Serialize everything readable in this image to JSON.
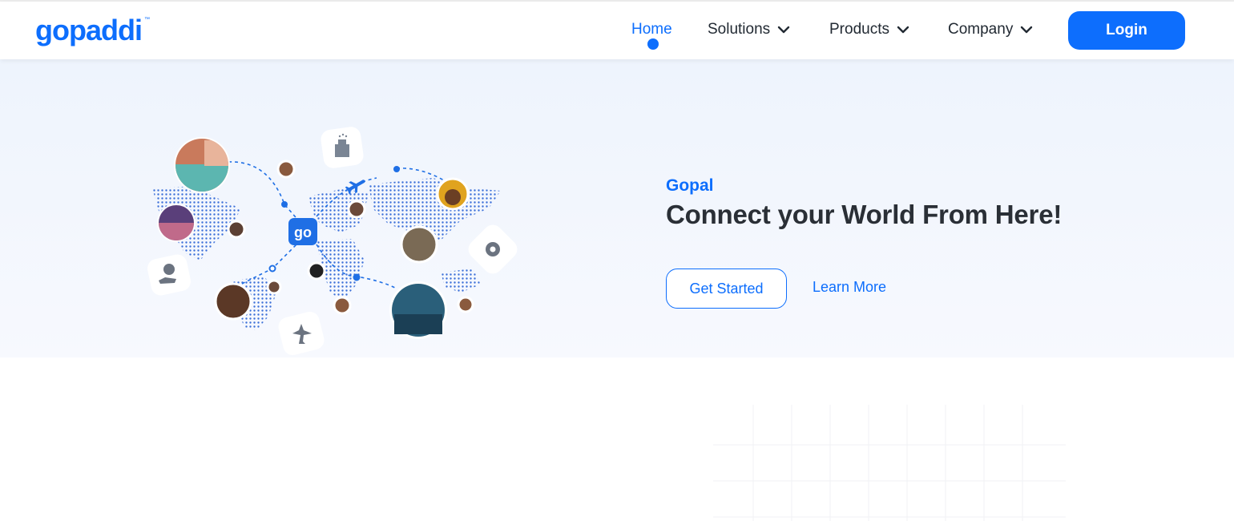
{
  "brand": {
    "logo_text": "gopaddi",
    "trademark": "™",
    "primary_color": "#0d6efd"
  },
  "nav": {
    "items": [
      {
        "label": "Home",
        "active": true
      },
      {
        "label": "Solutions",
        "icon": "chevron-down-icon"
      },
      {
        "label": "Products",
        "icon": "chevron-down-icon"
      },
      {
        "label": "Company",
        "icon": "chevron-down-icon"
      }
    ],
    "login_label": "Login"
  },
  "hero": {
    "eyebrow": "Gopal",
    "headline": "Connect your World From Here!",
    "primary_cta": "Get Started",
    "secondary_cta": "Learn More",
    "illustration_icons": [
      "hotel-icon",
      "airplane-icon",
      "money-hand-icon",
      "settings-badge-icon",
      "go-logo-icon"
    ]
  }
}
